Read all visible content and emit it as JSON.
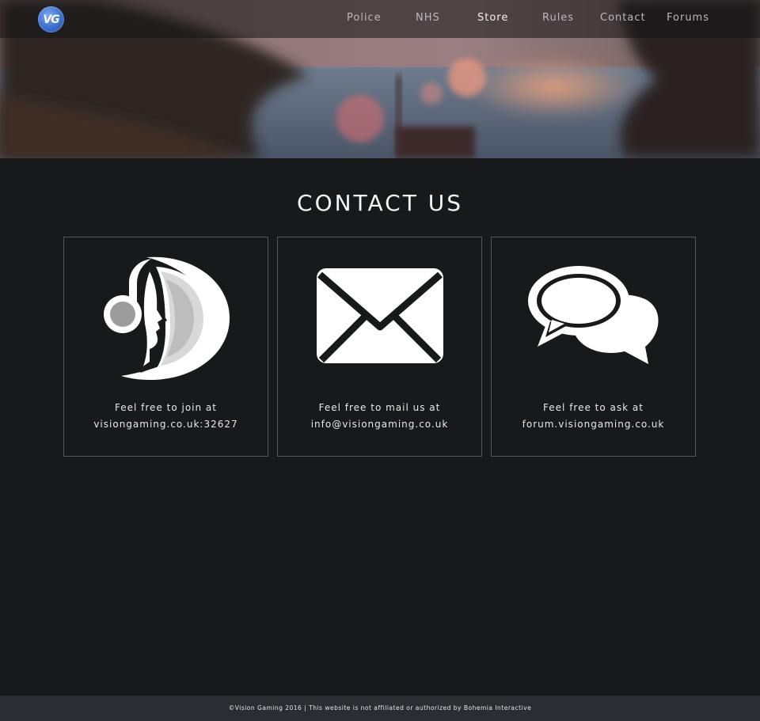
{
  "brand": {
    "logo_text": "VG",
    "accent_color": "#3a6fd1"
  },
  "nav": {
    "items": [
      {
        "label": "Police"
      },
      {
        "label": "NHS"
      },
      {
        "label": "Store",
        "active": true
      },
      {
        "label": "Rules"
      },
      {
        "label": "Contact"
      },
      {
        "label": "Forums"
      }
    ]
  },
  "main": {
    "title": "CONTACT US",
    "cards": [
      {
        "icon": "teamspeak-icon",
        "line1": "Feel free to join at",
        "line2": "visiongaming.co.uk:32627"
      },
      {
        "icon": "envelope-icon",
        "line1": "Feel free to mail us at",
        "line2": "info@visiongaming.co.uk"
      },
      {
        "icon": "chat-bubbles-icon",
        "line1": "Feel free to ask at",
        "line2": "forum.visiongaming.co.uk"
      }
    ]
  },
  "footer": {
    "text": "©Vision Gaming 2016 | This website is not affiliated or authorized by Bohemia Interactive"
  },
  "colors": {
    "background": "#18191b",
    "footer_background": "#2c2d33",
    "card_border": "#545559",
    "nav_text": "#b9b9bd"
  }
}
